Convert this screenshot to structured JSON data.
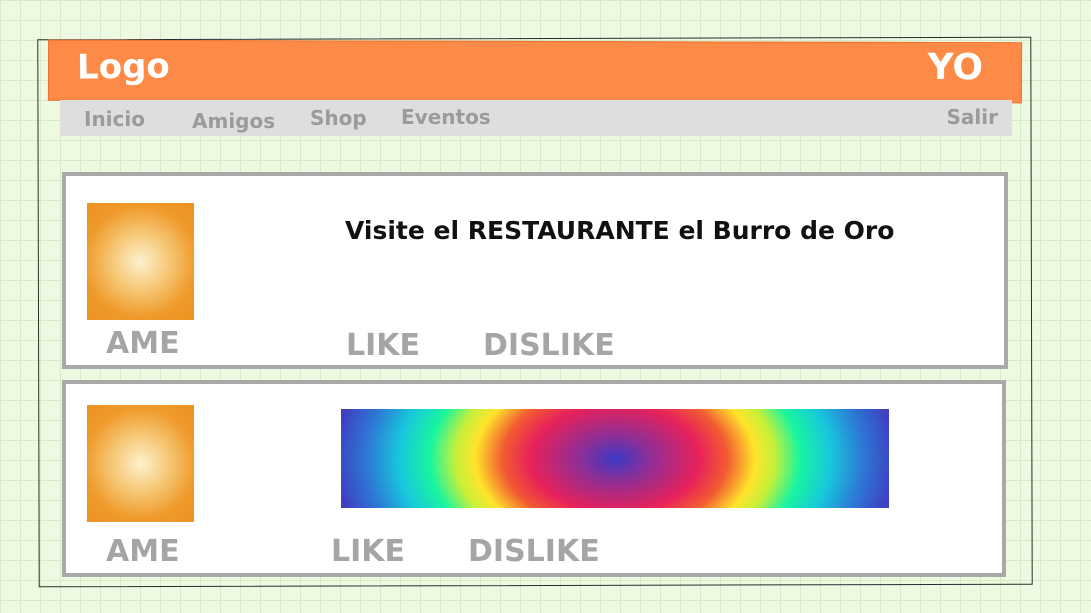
{
  "header": {
    "logo": "Logo",
    "user": "YO"
  },
  "nav": {
    "items": [
      "Inicio",
      "Amigos",
      "Shop",
      "Eventos"
    ],
    "logout": "Salir"
  },
  "posts": [
    {
      "author": "AME",
      "text": "Visite el RESTAURANTE el Burro de Oro",
      "like": "LIKE",
      "dislike": "DISLIKE"
    },
    {
      "author": "AME",
      "like": "LIKE",
      "dislike": "DISLIKE"
    }
  ],
  "colors": {
    "header": "#fd8b47",
    "navbar": "#dedede",
    "muted_text": "#a5a5a5",
    "avatar": "#ec9220"
  }
}
